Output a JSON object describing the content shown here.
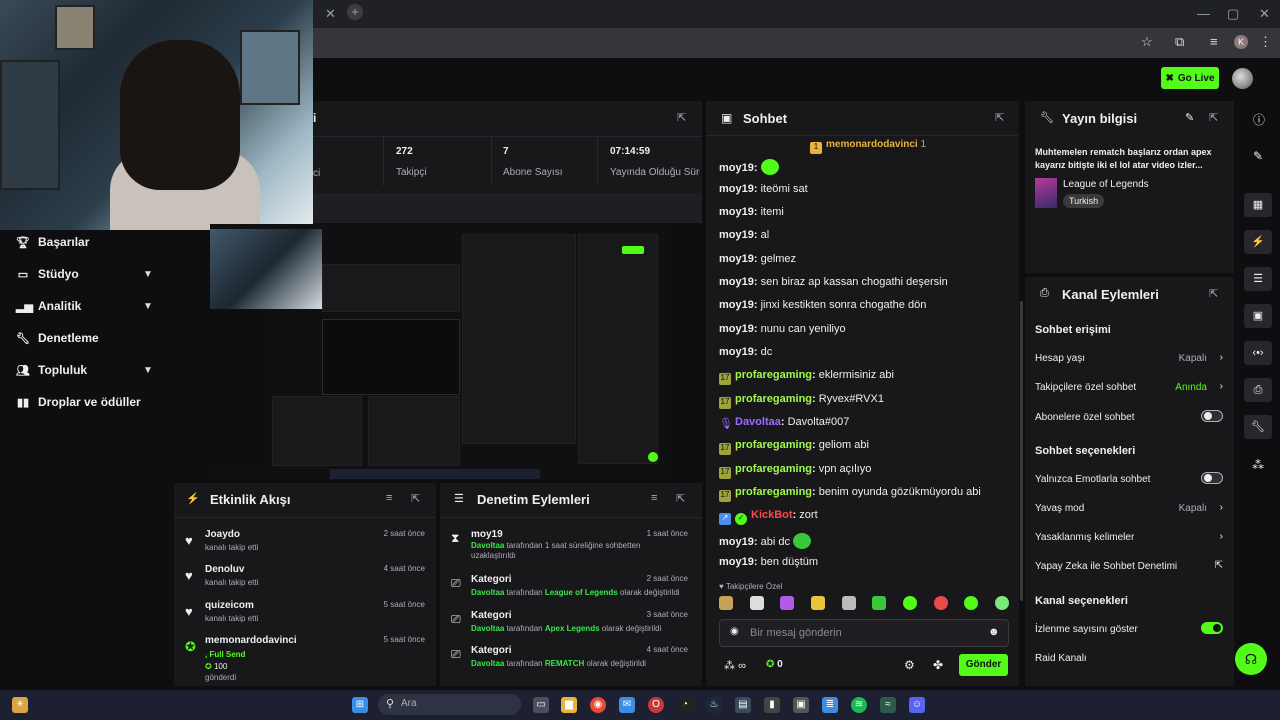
{
  "header": {
    "go_live": "Go Live"
  },
  "sidebar": {
    "items": [
      {
        "label": "Başarılar",
        "icon": "trophy-icon",
        "expandable": false
      },
      {
        "label": "Stüdyo",
        "icon": "studio-icon",
        "expandable": true
      },
      {
        "label": "Analitik",
        "icon": "analytics-icon",
        "expandable": true
      },
      {
        "label": "Denetleme",
        "icon": "wrench-icon",
        "expandable": false
      },
      {
        "label": "Topluluk",
        "icon": "community-icon",
        "expandable": true
      },
      {
        "label": "Droplar ve ödüller",
        "icon": "drops-icon",
        "expandable": false
      }
    ]
  },
  "stats": {
    "partial_label": "i",
    "partial_label2": "ci",
    "followers_value": "272",
    "followers_label": "Takipçi",
    "subs_value": "7",
    "subs_label": "Abone Sayısı",
    "uptime_value": "07:14:59",
    "uptime_label": "Yayında Olduğu Süre"
  },
  "chat": {
    "title": "Sohbet",
    "pinned_user": "memonardodavinci",
    "pinned_count": "1",
    "messages": [
      {
        "user": "moy19",
        "text": "",
        "emote": true
      },
      {
        "user": "moy19",
        "text": "iteömi sat"
      },
      {
        "user": "moy19",
        "text": "itemi"
      },
      {
        "user": "moy19",
        "text": "al"
      },
      {
        "user": "moy19",
        "text": "gelmez"
      },
      {
        "user": "moy19",
        "text": "sen biraz ap kassan chogathi deşersin"
      },
      {
        "user": "moy19",
        "text": "jinxi kestikten sonra chogathe dön"
      },
      {
        "user": "moy19",
        "text": "nunu can yeniliyo"
      },
      {
        "user": "moy19",
        "text": "dc"
      },
      {
        "user": "profaregaming",
        "text": "eklermisiniz abi"
      },
      {
        "user": "profaregaming",
        "text": "Ryvex#RVX1"
      },
      {
        "user": "Davoltaa",
        "text": "Davolta#007"
      },
      {
        "user": "profaregaming",
        "text": "geliom abi"
      },
      {
        "user": "profaregaming",
        "text": "vpn açılıyo"
      },
      {
        "user": "profaregaming",
        "text": "benim oyunda gözükmüyordu abi"
      },
      {
        "user": "KickBot",
        "text": "zort"
      },
      {
        "user": "moy19",
        "text": "abi dc",
        "emote": true
      },
      {
        "user": "moy19",
        "text": "ben düştüm"
      }
    ],
    "followers_only": "Takipçilere Özel",
    "input_placeholder": "Bir mesaj gönderin",
    "points": "∞",
    "kick_count": "0",
    "send": "Gönder"
  },
  "stream_info": {
    "title": "Yayın bilgisi",
    "description": "Muhtemelen rematch başlarız ordan apex kayarız bitişte iki el lol atar video izler...",
    "category": "League of Legends",
    "language": "Turkish"
  },
  "channel_actions": {
    "title": "Kanal Eylemleri",
    "chat_access": "Sohbet erişimi",
    "account_age": "Hesap yaşı",
    "account_age_val": "Kapalı",
    "followers_chat": "Takipçilere özel sohbet",
    "followers_chat_val": "Anında",
    "subs_chat": "Abonelere özel sohbet",
    "chat_options": "Sohbet seçenekleri",
    "emote_only": "Yalnızca Emotlarla sohbet",
    "slow_mode": "Yavaş mod",
    "slow_mode_val": "Kapalı",
    "banned_words": "Yasaklanmış kelimeler",
    "ai_mod": "Yapay Zeka ile Sohbet Denetimi",
    "channel_options": "Kanal seçenekleri",
    "show_viewers": "İzlenme sayısını göster",
    "raid": "Raid Kanalı"
  },
  "activity": {
    "title": "Etkinlik Akışı",
    "items": [
      {
        "name": "Joaydo",
        "sub": "kanalı takip etti",
        "time": "2 saat önce"
      },
      {
        "name": "Denoluv",
        "sub": "kanalı takip etti",
        "time": "4 saat önce"
      },
      {
        "name": "quizeicom",
        "sub": "kanalı takip etti",
        "time": "5 saat önce"
      },
      {
        "name": "memonardodavinci",
        "sub": ", Full Send",
        "extra": "100",
        "extra2": "gönderdi",
        "time": "5 saat önce"
      }
    ]
  },
  "moderation": {
    "title": "Denetim Eylemleri",
    "items": [
      {
        "name": "moy19",
        "actor": "Davoltaa",
        "pre": " tarafından 1 saat süreliğine sohbetten",
        "line2": "uzaklaştırıldı",
        "time": "1 saat önce"
      },
      {
        "name": "Kategori",
        "actor": "Davoltaa",
        "pre": " tarafından ",
        "hl": "League of Legends",
        "post": " olarak değiştirildi",
        "time": "2 saat önce"
      },
      {
        "name": "Kategori",
        "actor": "Davoltaa",
        "pre": " tarafından ",
        "hl": "Apex Legends",
        "post": " olarak değiştirildi",
        "time": "3 saat önce"
      },
      {
        "name": "Kategori",
        "actor": "Davoltaa",
        "pre": " tarafından ",
        "hl": "REMATCH",
        "post": " olarak değiştirildi",
        "time": "4 saat önce"
      }
    ]
  },
  "taskbar": {
    "search_placeholder": "Ara"
  },
  "colors": {
    "accent": "#53fc18",
    "panel": "#18181b",
    "bg": "#0e0e10",
    "kickbot": "#ff4a4a",
    "davoltaa": "#9d6bff",
    "profaregaming": "#a2f84a"
  }
}
